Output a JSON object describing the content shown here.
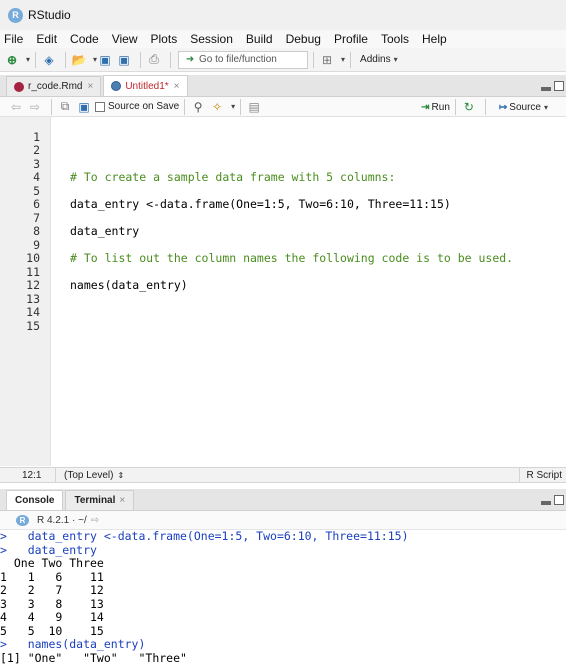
{
  "window": {
    "title": "RStudio",
    "logo_letter": "R"
  },
  "menu": [
    "File",
    "Edit",
    "Code",
    "View",
    "Plots",
    "Session",
    "Build",
    "Debug",
    "Profile",
    "Tools",
    "Help"
  ],
  "toolbar": {
    "goto_placeholder": "Go to file/function",
    "addins_label": "Addins"
  },
  "editor_tabs": [
    {
      "label": "r_code.Rmd",
      "active": false
    },
    {
      "label": "Untitled1*",
      "active": true
    }
  ],
  "editor_toolbar": {
    "source_on_save": "Source on Save",
    "run": "Run",
    "source": "Source"
  },
  "code_lines": [
    {
      "n": "1",
      "text": "",
      "kind": "code"
    },
    {
      "n": "2",
      "text": "",
      "kind": "code"
    },
    {
      "n": "3",
      "text": "# To create a sample data frame with 5 columns:",
      "kind": "comment"
    },
    {
      "n": "4",
      "text": "",
      "kind": "code"
    },
    {
      "n": "5",
      "text": "data_entry <-data.frame(One=1:5, Two=6:10, Three=11:15)",
      "kind": "code"
    },
    {
      "n": "6",
      "text": "",
      "kind": "code"
    },
    {
      "n": "7",
      "text": "data_entry",
      "kind": "code"
    },
    {
      "n": "8",
      "text": "",
      "kind": "code"
    },
    {
      "n": "9",
      "text": "# To list out the column names the following code is to be used.",
      "kind": "comment"
    },
    {
      "n": "10",
      "text": "",
      "kind": "code"
    },
    {
      "n": "11",
      "text": "names(data_entry)",
      "kind": "code"
    },
    {
      "n": "12",
      "text": "",
      "kind": "code"
    },
    {
      "n": "13",
      "text": "",
      "kind": "code"
    },
    {
      "n": "14",
      "text": "",
      "kind": "code"
    },
    {
      "n": "15",
      "text": "",
      "kind": "code"
    }
  ],
  "editor_status": {
    "position": "12:1",
    "scope": "(Top Level)",
    "file_type": "R Script"
  },
  "console_tabs": [
    {
      "label": "Console",
      "active": true
    },
    {
      "label": "Terminal",
      "active": false
    }
  ],
  "console_sub": {
    "version": "R 4.2.1 · ~/"
  },
  "console_lines": [
    {
      "text": ">   data_entry <-data.frame(One=1:5, Two=6:10, Three=11:15)",
      "kind": "cmd"
    },
    {
      "text": ">   data_entry",
      "kind": "cmd"
    },
    {
      "text": "  One Two Three",
      "kind": "out"
    },
    {
      "text": "1   1   6    11",
      "kind": "out"
    },
    {
      "text": "2   2   7    12",
      "kind": "out"
    },
    {
      "text": "3   3   8    13",
      "kind": "out"
    },
    {
      "text": "4   4   9    14",
      "kind": "out"
    },
    {
      "text": "5   5  10    15",
      "kind": "out"
    },
    {
      "text": ">   names(data_entry)",
      "kind": "cmd"
    },
    {
      "text": "[1] \"One\"   \"Two\"   \"Three\"",
      "kind": "out"
    }
  ]
}
